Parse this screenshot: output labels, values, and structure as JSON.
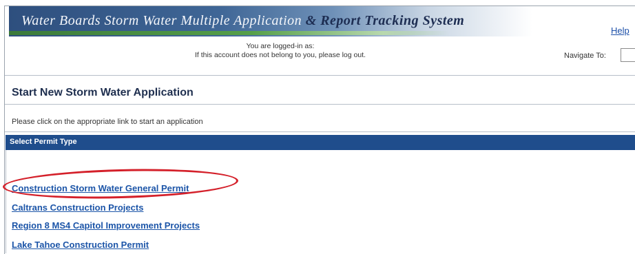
{
  "header": {
    "title_part1": "Water Boards Storm Water Multiple Application ",
    "title_part2": "& Report Tracking System",
    "help_label": "Help"
  },
  "login": {
    "line1": "You are logged-in as:",
    "line2": "If this account does not belong to you, please log out."
  },
  "navigate": {
    "label": "Navigate To:",
    "value": ""
  },
  "page": {
    "title": "Start New Storm Water Application",
    "instructions": "Please click on the appropriate link to start an application"
  },
  "section": {
    "header": "Select Permit Type"
  },
  "permits": [
    {
      "label": "Construction Storm Water General Permit"
    },
    {
      "label": "Caltrans Construction Projects"
    },
    {
      "label": "Region 8 MS4 Capitol Improvement Projects"
    },
    {
      "label": "Lake Tahoe Construction Permit"
    }
  ],
  "colors": {
    "section_header": "#1f4d8c",
    "link": "#1c55a8",
    "highlight": "#d4202a"
  }
}
